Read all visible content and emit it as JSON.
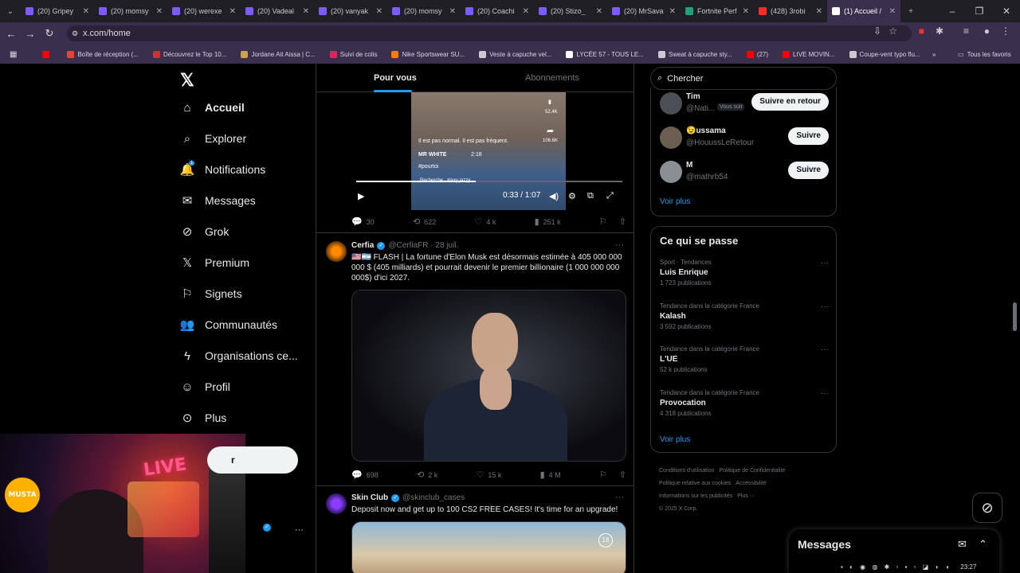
{
  "browser": {
    "tabs": [
      {
        "label": "(20) Gripey",
        "color": "#7d5cff",
        "active": false
      },
      {
        "label": "(20) momsy",
        "color": "#7d5cff",
        "active": false
      },
      {
        "label": "(20) werexe",
        "color": "#7d5cff",
        "active": false
      },
      {
        "label": "(20) Vadeal",
        "color": "#7d5cff",
        "active": false
      },
      {
        "label": "(20) vanyak",
        "color": "#7d5cff",
        "active": false
      },
      {
        "label": "(20) momsy",
        "color": "#7d5cff",
        "active": false
      },
      {
        "label": "(20) Coachi",
        "color": "#7d5cff",
        "active": false
      },
      {
        "label": "(20) Stizo_",
        "color": "#7d5cff",
        "active": false
      },
      {
        "label": "(20) MrSava",
        "color": "#7d5cff",
        "active": false
      },
      {
        "label": "Fortnite Perf",
        "color": "#22a07a",
        "active": false
      },
      {
        "label": "(428) 3robi",
        "color": "#ff2a2a",
        "active": false
      },
      {
        "label": "(1) Accueil /",
        "color": "#ffffff",
        "active": true
      }
    ],
    "url": "x.com/home",
    "bookmarks": [
      {
        "label": "",
        "color": "#ff0000"
      },
      {
        "label": "Boîte de réception (...",
        "color": "#ea4335"
      },
      {
        "label": "Découvrez le Top 10...",
        "color": "#d32f2f"
      },
      {
        "label": "Jordane Ait Aissa | C...",
        "color": "#c9a24a"
      },
      {
        "label": "Suivi de colis",
        "color": "#e0245e"
      },
      {
        "label": "Nike Sportswear SU...",
        "color": "#ff7a00"
      },
      {
        "label": "Veste à capuche vel...",
        "color": "#cccccc"
      },
      {
        "label": "LYCÉE 57 - TOUS LE...",
        "color": "#ffffff"
      },
      {
        "label": "Sweat à capuche sty...",
        "color": "#cccccc"
      },
      {
        "label": "(27)",
        "color": "#ff0000"
      },
      {
        "label": "LIVE MOVIN...",
        "color": "#ff0000"
      },
      {
        "label": "Coupe-vent typo flu...",
        "color": "#cccccc"
      }
    ],
    "all_bookmarks": "Tous les favoris"
  },
  "sidebar": {
    "items": [
      {
        "label": "Accueil",
        "icon": "home-icon"
      },
      {
        "label": "Explorer",
        "icon": "search-icon"
      },
      {
        "label": "Notifications",
        "icon": "bell-icon",
        "badge": "1"
      },
      {
        "label": "Messages",
        "icon": "envelope-icon"
      },
      {
        "label": "Grok",
        "icon": "grok-icon"
      },
      {
        "label": "Premium",
        "icon": "x-icon"
      },
      {
        "label": "Signets",
        "icon": "bookmark-icon"
      },
      {
        "label": "Communautés",
        "icon": "people-icon"
      },
      {
        "label": "Organisations ce...",
        "icon": "bolt-icon"
      },
      {
        "label": "Profil",
        "icon": "person-icon"
      },
      {
        "label": "Plus",
        "icon": "more-circle-icon"
      }
    ],
    "post_label": "r"
  },
  "feed": {
    "tabs": {
      "for_you": "Pour vous",
      "following": "Abonnements"
    },
    "video": {
      "caption1": "Il est pas normal. Il est pas fréquent.",
      "caption2": "MR WHITE",
      "time_small": "2:18",
      "hashtag": "#pourtoi",
      "search_text": "Recherche · klaxy jazzy",
      "likes_side": "52.4K",
      "shares_side": "106.6K",
      "time": "0:33 / 1:07",
      "progress": 0.45
    },
    "tweet0_actions": {
      "replies": "30",
      "retweets": "622",
      "likes": "4 k",
      "views": "251 k"
    },
    "tweet1": {
      "name": "Cerfia",
      "handle": "@CerfiaFR · 28 juil.",
      "text": "🇺🇸🇦🇷 FLASH | La fortune d'Elon Musk est désormais estimée à 405 000 000 000 $ (405 milliards) et pourrait devenir le premier billionaire (1 000 000 000 000$) d'ici 2027.",
      "replies": "698",
      "retweets": "2 k",
      "likes": "15 k",
      "views": "4 M"
    },
    "tweet2": {
      "name": "Skin Club",
      "handle": "@skinclub_cases",
      "text": "Deposit now and get up to 100 CS2 FREE CASES!  It's time for an upgrade!",
      "media_badge": "18"
    }
  },
  "right": {
    "search_placeholder": "Chercher",
    "suggestions": [
      {
        "name": "Tim",
        "handle": "@Nati...",
        "badge": "Vous suit",
        "button": "Suivre en retour"
      },
      {
        "name": "😉ussama",
        "handle": "@HouussLeRetour",
        "button": "Suivre"
      },
      {
        "name": "M",
        "handle": "@mathrb54",
        "button": "Suivre"
      }
    ],
    "see_more": "Voir plus",
    "trends_title": "Ce qui se passe",
    "trends": [
      {
        "context": "Sport · Tendances",
        "name": "Luis Enrique",
        "count": "1 723 publications"
      },
      {
        "context": "Tendance dans la catégorie France",
        "name": "Kalash",
        "count": "3 592 publications"
      },
      {
        "context": "Tendance dans la catégorie France",
        "name": "L'UE",
        "count": "52 k publications"
      },
      {
        "context": "Tendance dans la catégorie France",
        "name": "Provocation",
        "count": "4 318 publications"
      }
    ],
    "trends_more": "Voir plus",
    "footer": [
      "Conditions d'utilisation",
      "Politique de Confidentialité",
      "Politique relative aux cookies",
      "Accessibilité",
      "Informations sur les publicités",
      "Plus ···",
      "© 2025 X Corp."
    ]
  },
  "messages_drawer": {
    "title": "Messages"
  },
  "webcam": {
    "neon1": "LIVE",
    "neon2": "MUSTA"
  },
  "taskbar": {
    "time": "23:27"
  }
}
